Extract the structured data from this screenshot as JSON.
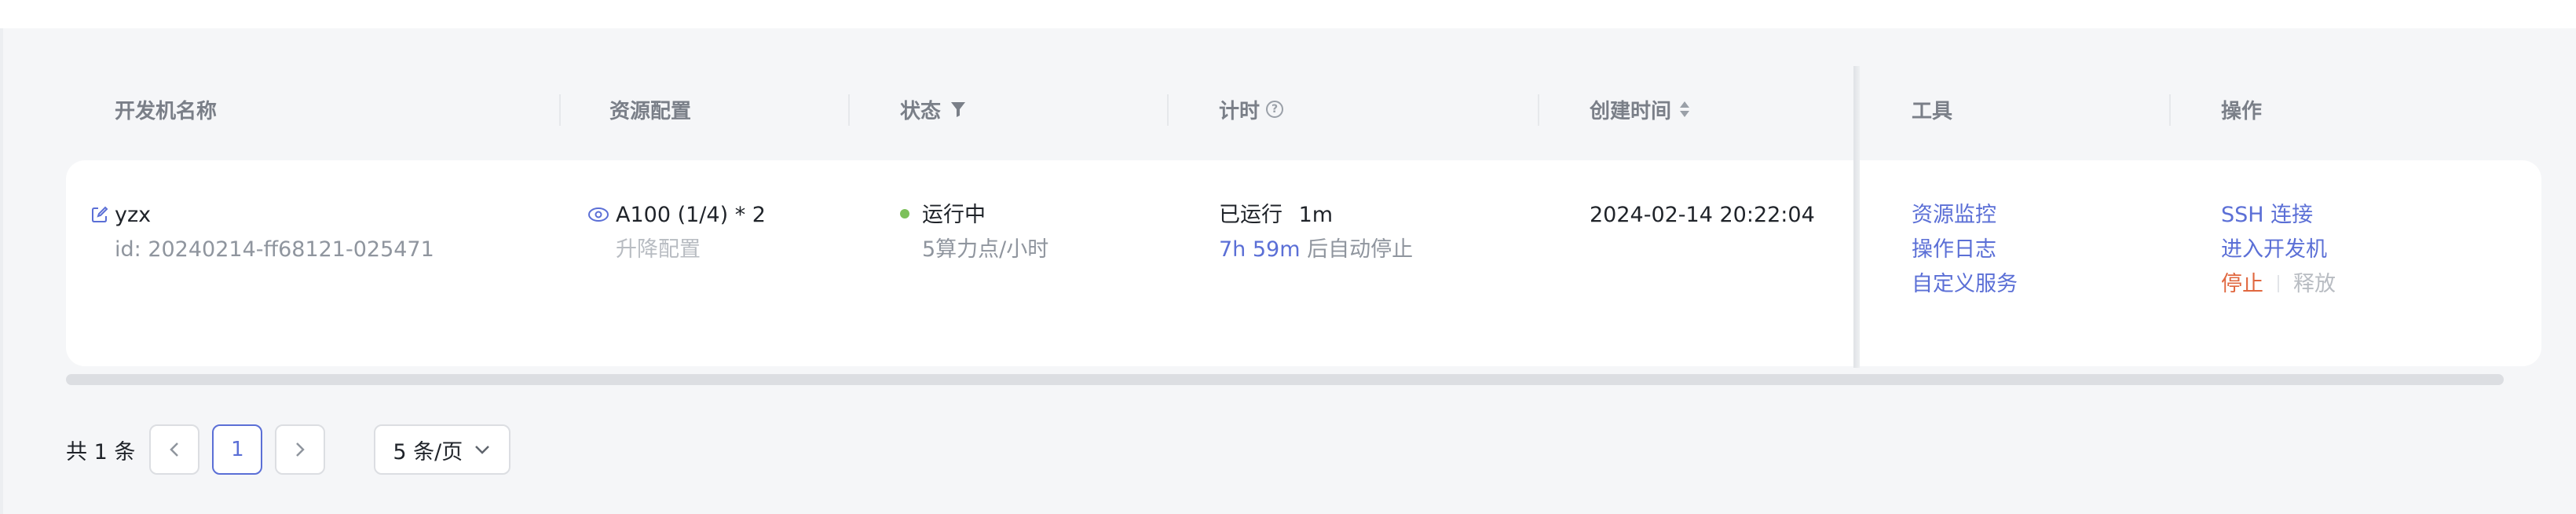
{
  "table": {
    "columns": {
      "name": "开发机名称",
      "resource": "资源配置",
      "status": "状态",
      "timer": "计时",
      "created": "创建时间",
      "tools": "工具",
      "actions": "操作"
    },
    "row": {
      "name": "yzx",
      "id": "id: 20240214-ff68121-025471",
      "resource": "A100 (1/4) * 2",
      "upgrade": "升降配置",
      "status": "运行中",
      "rate": "5算力点/小时",
      "running_label": "已运行",
      "running_time": "1m",
      "remaining": "7h 59m",
      "auto_stop": "后自动停止",
      "created": "2024-02-14 20:22:04",
      "tools": [
        "资源监控",
        "操作日志",
        "自定义服务"
      ],
      "actions": {
        "ssh": "SSH 连接",
        "enter": "进入开发机",
        "stop": "停止",
        "release": "释放"
      }
    }
  },
  "pagination": {
    "total": "共 1 条",
    "prev": "<",
    "page": "1",
    "next": ">",
    "page_size": "5 条/页"
  },
  "colors": {
    "link": "#5b6fd6",
    "danger": "#e0673f",
    "running": "#7cc05a"
  },
  "icons": {
    "edit": "edit-icon",
    "view": "eye-icon",
    "filter": "filter-icon",
    "help": "help-icon",
    "sort": "sort-icon",
    "dropdown": "chevron-down-icon"
  }
}
